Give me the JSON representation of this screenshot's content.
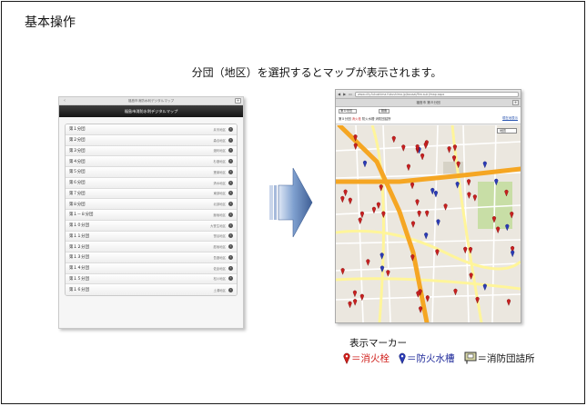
{
  "slide": {
    "title": "基本操作",
    "subtitle": "分団（地区）を選択するとマップが表示されます。"
  },
  "phone": {
    "status_title": "福島市消防水利デジタルマップ",
    "back_glyph": "‹",
    "header_title": "福島市消防水利デジタルマップ",
    "arrow_glyph": "›",
    "items": [
      {
        "label": "第１分団",
        "sub": "弁天地区"
      },
      {
        "label": "第２分団",
        "sub": "森合地区"
      },
      {
        "label": "第３分団",
        "sub": "渡利地区"
      },
      {
        "label": "第４分団",
        "sub": "杉妻地区"
      },
      {
        "label": "第５分団",
        "sub": "蓬莱地区"
      },
      {
        "label": "第６分団",
        "sub": "清水地区"
      },
      {
        "label": "第７分団",
        "sub": "東部地区"
      },
      {
        "label": "第８分団",
        "sub": "北部地区"
      },
      {
        "label": "第１－８分団",
        "sub": "飯坂地区"
      },
      {
        "label": "第１０分団",
        "sub": "大笹生地区"
      },
      {
        "label": "第１１分団",
        "sub": "笹谷地区"
      },
      {
        "label": "第１２分団",
        "sub": "庭坂地区"
      },
      {
        "label": "第１３分団",
        "sub": "吾妻地区"
      },
      {
        "label": "第１４分団",
        "sub": "佐倉地区"
      },
      {
        "label": "第１５分団",
        "sub": "松川地区"
      },
      {
        "label": "第１６分団",
        "sub": "土湯地区"
      }
    ]
  },
  "mapshot": {
    "url": "www.city.fukushima.fukushima.jp/bousai/fire-suiri/map.aspx",
    "tab_title": "福島市 第８分団",
    "select_value": "第８分団",
    "go_label": "検索",
    "crumb_prefix": "第８分団",
    "crumb_red": "消火栓",
    "crumb_rest": "防火水槽 消防団詰所",
    "right_link": "現在地表示",
    "map_type": "地図"
  },
  "legend": {
    "title": "表示マーカー",
    "items": [
      {
        "label": "＝消火栓",
        "color": "#d0201c"
      },
      {
        "label": "＝防火水槽",
        "color": "#1f2a9a"
      },
      {
        "label": "＝消防団詰所",
        "color": "#111111"
      }
    ]
  },
  "colors": {
    "phone_header": "#151515",
    "arrow_fill": "#5c80b8",
    "major_road": "#f5a623",
    "minor_road": "#fff59a",
    "park": "#c8dea6"
  },
  "icons": {
    "legend_hydrant": "red-map-pin-icon",
    "legend_cistern": "blue-map-pin-icon",
    "legend_station": "fire-station-marker-icon"
  }
}
